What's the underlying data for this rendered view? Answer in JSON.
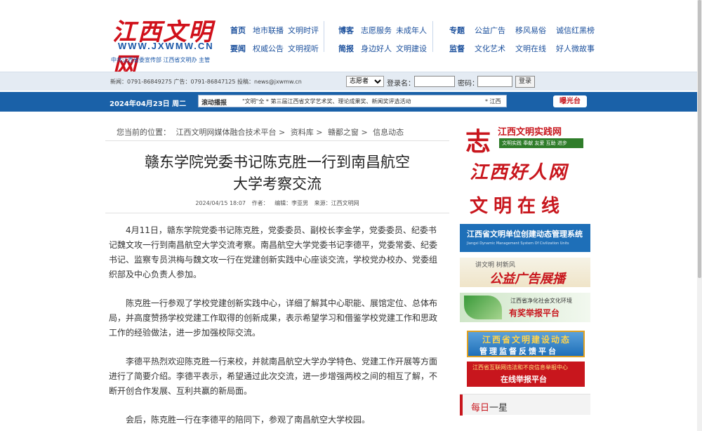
{
  "site": {
    "logo_cn": "江西文明网",
    "logo_en": "WWW.JXWMW.CN",
    "logo_sub": "中共江西省委宣传部  江西省文明办 主管"
  },
  "nav": {
    "group1": [
      {
        "main": "首页",
        "items": [
          "地市联播",
          "文明时评"
        ]
      },
      {
        "main": "要闻",
        "items": [
          "权威公告",
          "文明视听"
        ]
      }
    ],
    "group2": [
      {
        "main": "博客",
        "items": [
          "志愿服务",
          "未成年人"
        ]
      },
      {
        "main": "简报",
        "items": [
          "身边好人",
          "文明建设"
        ]
      }
    ],
    "group3": [
      {
        "main": "专题",
        "items": [
          "公益广告",
          "移风易俗",
          "诚信红黑榜"
        ]
      },
      {
        "main": "监督",
        "items": [
          "文化艺术",
          "文明在线",
          "好人微故事"
        ]
      }
    ]
  },
  "loginbar": {
    "info": "新闻：0791-86849275    广告：0791-86847125    投稿：news@jxwmw.cn",
    "select_value": "志愿者",
    "username_label": "登录名：",
    "password_label": "密码：",
    "login_button": "登录"
  },
  "bluebar": {
    "date": "2024年04月23日 周二",
    "scroll_tag": "滚动播报",
    "scroll_text": "\"文明\"全 * 第三届江西省文学艺术奖、理论成果奖、新闻奖评选活动",
    "scroll_text2": "* 江西",
    "exposure": "曝光台"
  },
  "breadcrumb": {
    "prefix": "您当前的位置：",
    "items": [
      "江西文明网媒体融合技术平台",
      ">",
      "资料库",
      ">",
      "赣鄱之窗",
      ">",
      "信息动态"
    ]
  },
  "article": {
    "title_line1": "赣东学院党委书记陈克胜一行到南昌航空",
    "title_line2": "大学考察交流",
    "date": "2024/04/15 18:07",
    "author_label": "作者：",
    "editor": "编辑：李亚男",
    "source": "来源：江西文明网",
    "paragraphs": [
      "4月11日，赣东学院党委书记陈克胜，党委委员、副校长李金学，党委委员、纪委书记魏文攻一行到南昌航空大学交流考察。南昌航空大学党委书记李德平，党委常委、纪委书记、监察专员洪梅与魏文攻一行在党建创新实践中心座谈交流，学校党办校办、党委组织部及中心负责人参加。",
      "陈克胜一行参观了学校党建创新实践中心，详细了解其中心职能、展馆定位、总体布局，并高度赞扬学校党建工作取得的创新成果，表示希望学习和借鉴学校党建工作和思政工作的经验做法，进一步加强校际交流。",
      "李德平热烈欢迎陈克胜一行来校，并就南昌航空大学办学特色、党建工作开展等方面进行了简要介绍。李德平表示，希望通过此次交流，进一步增强两校之间的相互了解，不断开创合作发展、互利共赢的新局面。",
      "会后，陈克胜一行在李德平的陪同下，参观了南昌航空大学校园。"
    ]
  },
  "sidebar": {
    "practice_title": "江西文明实践网",
    "practice_sub": "文明实践 奉献 友爱 互助 进步",
    "practice_logo": "志",
    "goodman": "江西好人网",
    "online": "文明在线",
    "dynamic_title": "江西省文明单位创建动态管理系统",
    "dynamic_sub": "Jiangxi Dynamic Management System Of Civilization Units",
    "psa_sub": "讲文明  树新风",
    "psa_title": "公益广告展播",
    "report_sub": "江西省净化社会文化环境",
    "report_title": "有奖举报平台",
    "supervise_line1": "江西省文明建设动态",
    "supervise_line2": "管理监督反馈平台",
    "internet_line1": "江西省互联网违法和不良信息举报中心",
    "internet_line2": "在线举报平台",
    "daily_red": "每日",
    "daily_black": "一星"
  },
  "colors": {
    "brand_red": "#c8161d",
    "brand_blue": "#1a61a8"
  }
}
